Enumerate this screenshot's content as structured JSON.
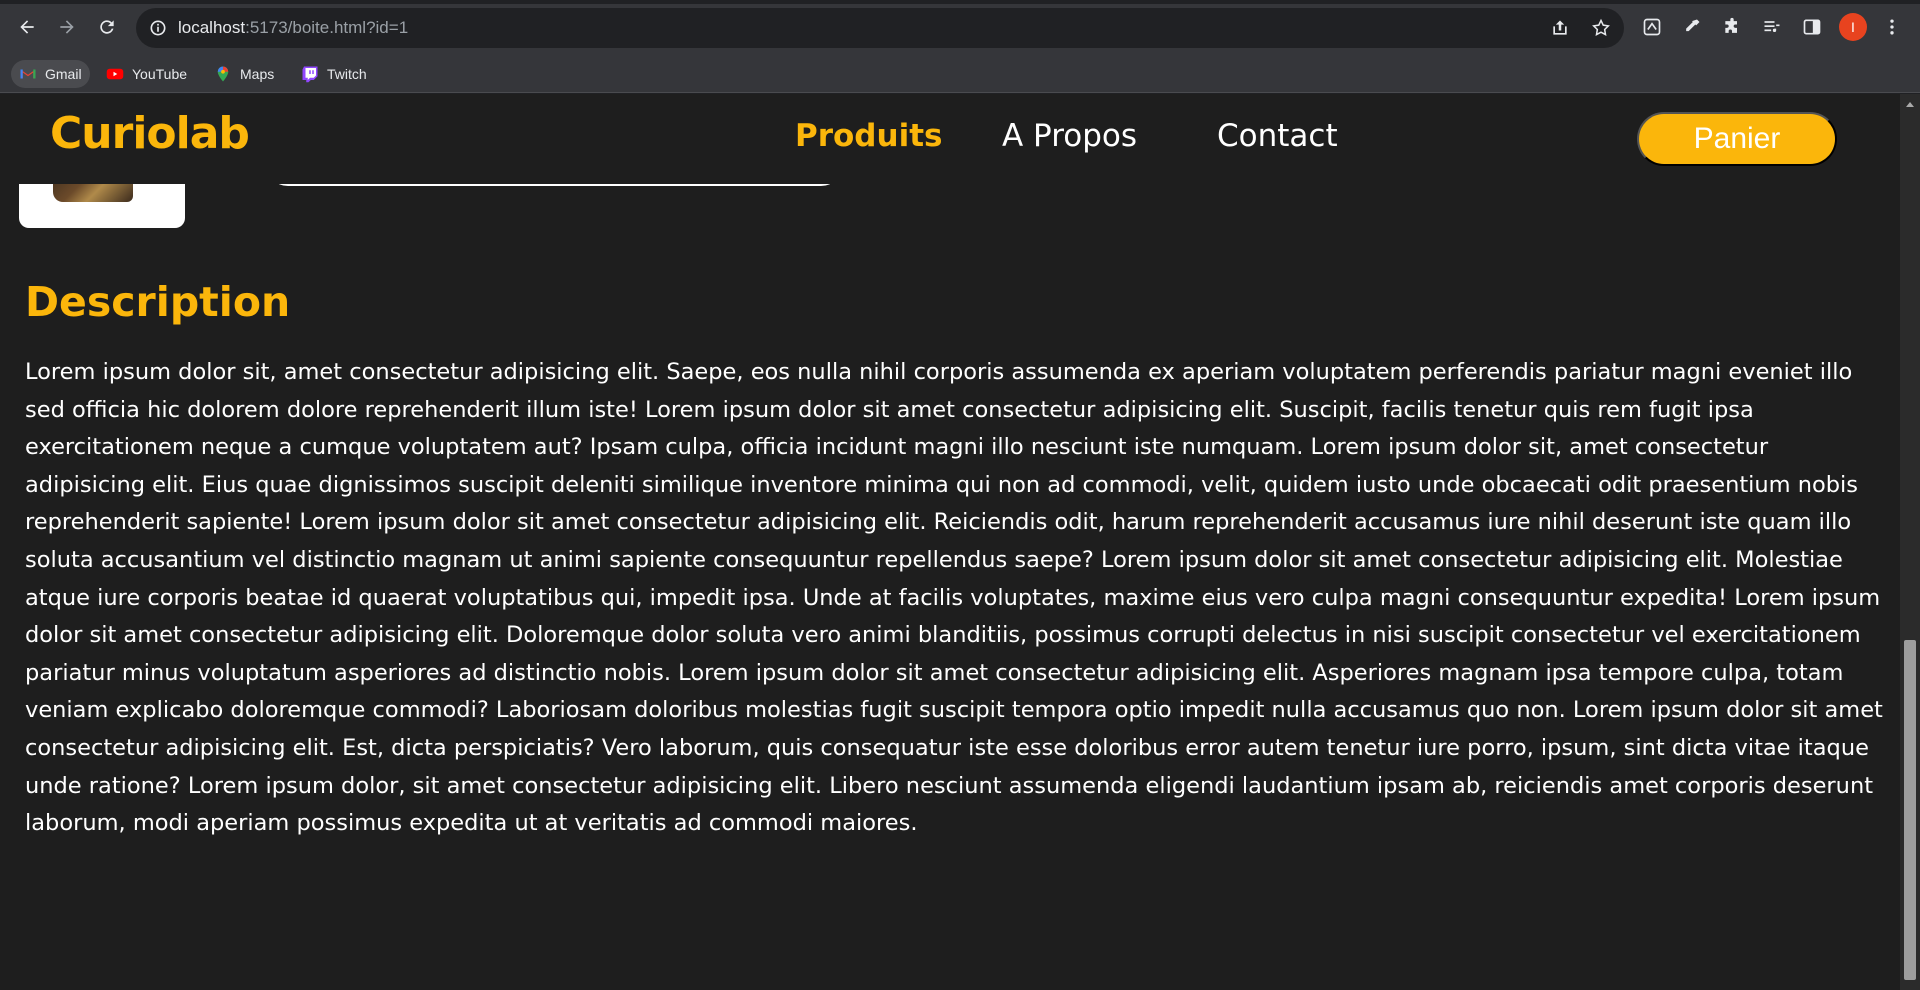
{
  "browser": {
    "url_host": "localhost",
    "url_rest": ":5173/boite.html?id=1",
    "profile_initial": "I",
    "bookmarks": [
      {
        "label": "Gmail"
      },
      {
        "label": "YouTube"
      },
      {
        "label": "Maps"
      },
      {
        "label": "Twitch"
      }
    ]
  },
  "site": {
    "logo": "Curiolab",
    "nav": {
      "products": "Produits",
      "about": "A Propos",
      "contact": "Contact"
    },
    "cart_label": "Panier",
    "accent_color": "#fbb60b"
  },
  "description": {
    "title": "Description",
    "body": "Lorem ipsum dolor sit, amet consectetur adipisicing elit. Saepe, eos nulla nihil corporis assumenda ex aperiam voluptatem perferendis pariatur magni eveniet illo sed officia hic dolorem dolore reprehenderit illum iste! Lorem ipsum dolor sit amet consectetur adipisicing elit. Suscipit, facilis tenetur quis rem fugit ipsa exercitationem neque a cumque voluptatem aut? Ipsam culpa, officia incidunt magni illo nesciunt iste numquam. Lorem ipsum dolor sit, amet consectetur adipisicing elit. Eius quae dignissimos suscipit deleniti similique inventore minima qui non ad commodi, velit, quidem iusto unde obcaecati odit praesentium nobis reprehenderit sapiente! Lorem ipsum dolor sit amet consectetur adipisicing elit. Reiciendis odit, harum reprehenderit accusamus iure nihil deserunt iste quam illo soluta accusantium vel distinctio magnam ut animi sapiente consequuntur repellendus saepe? Lorem ipsum dolor sit amet consectetur adipisicing elit. Molestiae atque iure corporis beatae id quaerat voluptatibus qui, impedit ipsa. Unde at facilis voluptates, maxime eius vero culpa magni consequuntur expedita! Lorem ipsum dolor sit amet consectetur adipisicing elit. Doloremque dolor soluta vero animi blanditiis, possimus corrupti delectus in nisi suscipit consectetur vel exercitationem pariatur minus voluptatum asperiores ad distinctio nobis. Lorem ipsum dolor sit amet consectetur adipisicing elit. Asperiores magnam ipsa tempore culpa, totam veniam explicabo doloremque commodi? Laboriosam doloribus molestias fugit suscipit tempora optio impedit nulla accusamus quo non. Lorem ipsum dolor sit amet consectetur adipisicing elit. Est, dicta perspiciatis? Vero laborum, quis consequatur iste esse doloribus error autem tenetur iure porro, ipsum, sint dicta vitae itaque unde ratione? Lorem ipsum dolor, sit amet consectetur adipisicing elit. Libero nesciunt assumenda eligendi laudantium ipsam ab, reiciendis amet corporis deserunt laborum, modi aperiam possimus expedita ut at veritatis ad commodi maiores."
  }
}
